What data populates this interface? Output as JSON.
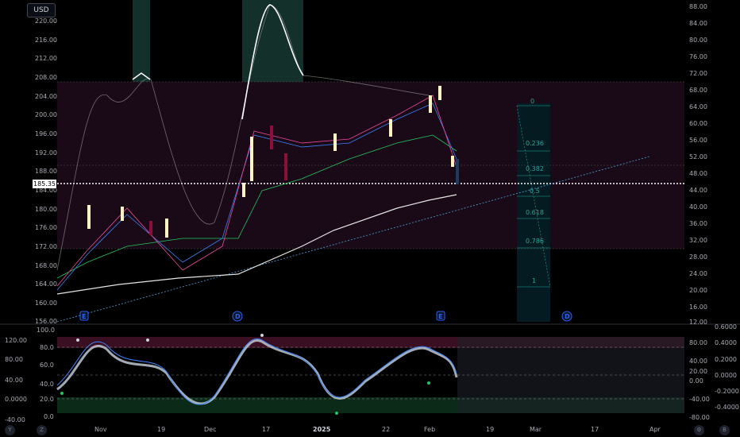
{
  "currency_button": "USD",
  "current_price": "185.35",
  "price_axis_left": [
    "220.00",
    "216.00",
    "212.00",
    "208.00",
    "204.00",
    "200.00",
    "196.00",
    "192.00",
    "188.00",
    "184.00",
    "180.00",
    "176.00",
    "172.00",
    "168.00",
    "164.00",
    "160.00",
    "156.00"
  ],
  "price_axis_right": [
    "88.00",
    "84.00",
    "80.00",
    "76.00",
    "72.00",
    "68.00",
    "64.00",
    "60.00",
    "56.00",
    "52.00",
    "48.00",
    "44.00",
    "40.00",
    "36.00",
    "32.00",
    "28.00",
    "24.00",
    "20.00",
    "16.00",
    "12.00"
  ],
  "osc_axis_left": [
    "100.0",
    "120.00",
    "80.0",
    "80.00",
    "60.0",
    "40.00",
    "40.0",
    "20.0",
    "0.0000",
    "0.0",
    "-40.00"
  ],
  "osc_axis_right_a": [
    "80.00",
    "40.00",
    "20.00",
    "0.00",
    "-40.00",
    "-80.00"
  ],
  "osc_axis_right_b": [
    "0.6000",
    "0.4000",
    "0.2000",
    "0.0000",
    "-0.2000",
    "-0.4000"
  ],
  "time_axis": [
    "Nov",
    "19",
    "Dec",
    "17",
    "2025",
    "22",
    "Feb",
    "19",
    "Mar",
    "17",
    "Apr"
  ],
  "fib_levels": [
    "0",
    "0.236",
    "0.382",
    "0.5",
    "0.618",
    "0.786",
    "1"
  ],
  "event_markers": [
    "E",
    "D",
    "E",
    "D"
  ],
  "corner_buttons": {
    "bottom_left_y": "Y",
    "bottom_left_z": "Z",
    "bottom_right_gear": "⚙",
    "bottom_right_b": "B"
  },
  "colors": {
    "up": "#fff3c4",
    "down": "#8b0f3a",
    "ma_green": "#22c55e",
    "ma_white": "#e0e0e0",
    "ma_blue": "#3b82f6",
    "ma_pink": "#ec4899",
    "fib": "#26a69a",
    "accent": "#2962ff"
  },
  "chart_data": {
    "type": "candlestick",
    "currency": "USD",
    "current_price": 185.35,
    "fib_levels": [
      0,
      0.236,
      0.382,
      0.5,
      0.618,
      0.786,
      1
    ]
  }
}
